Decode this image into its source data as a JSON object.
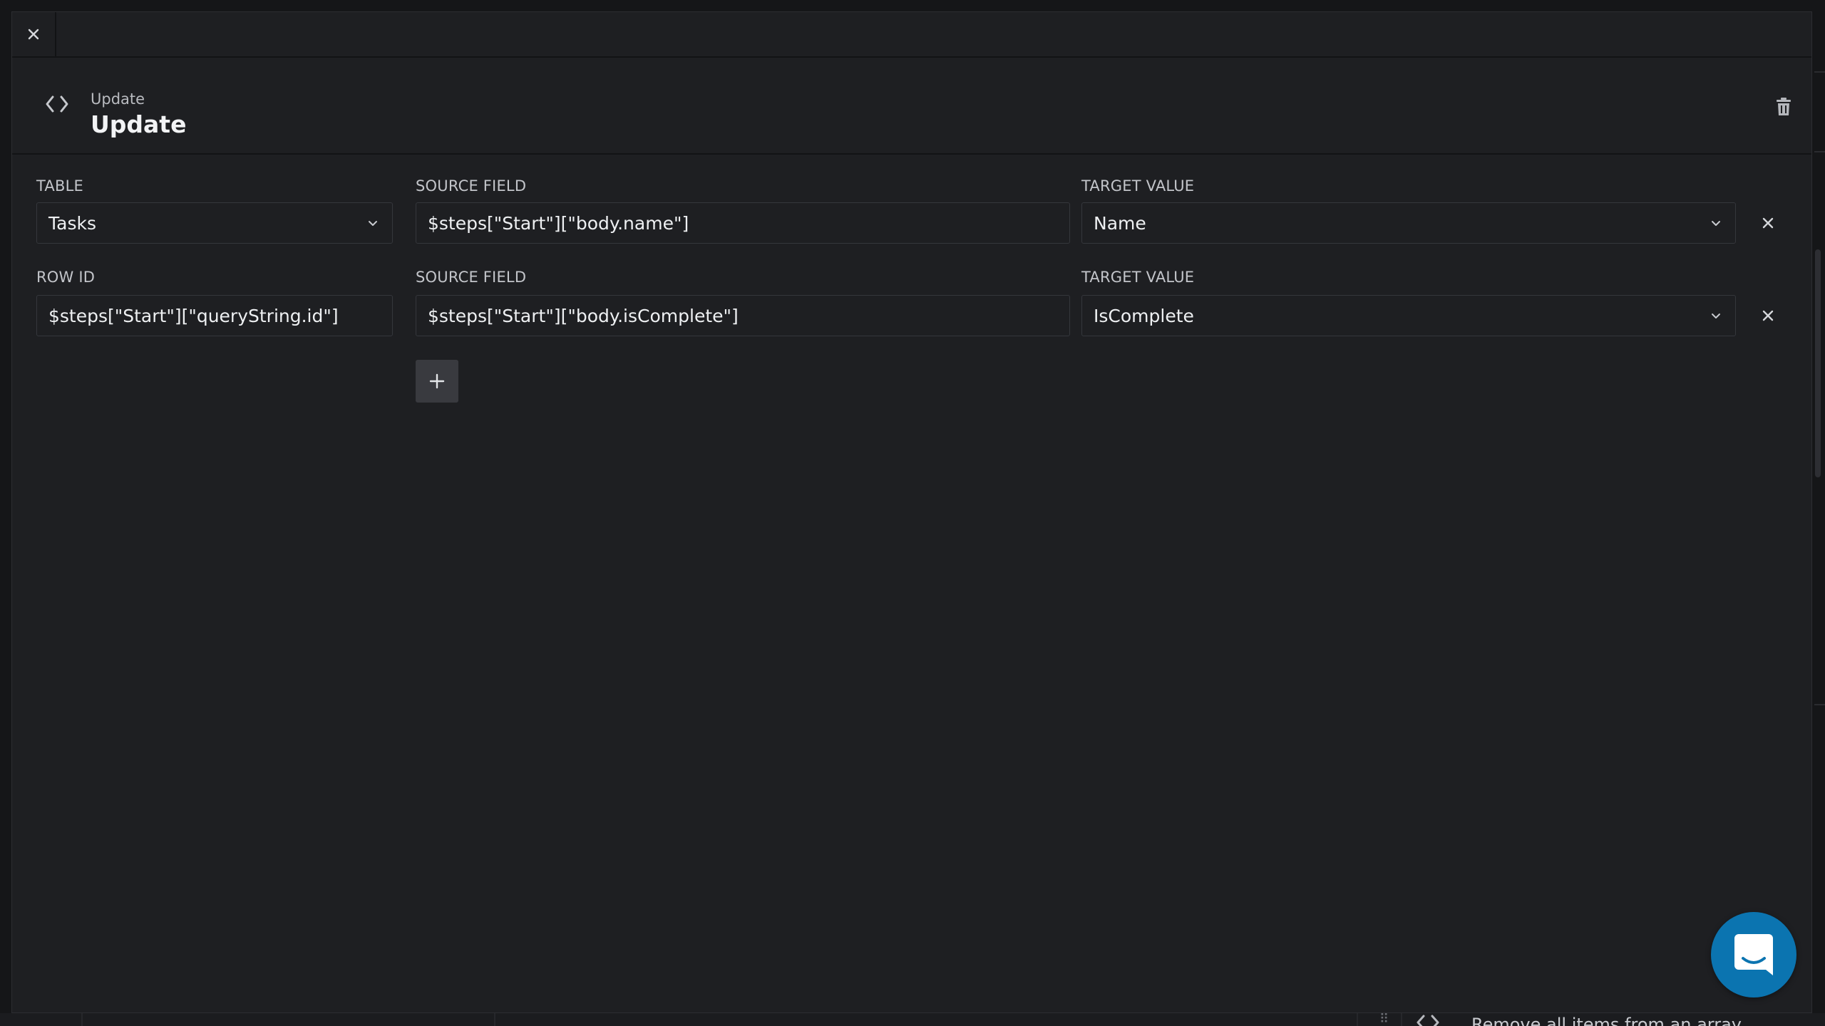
{
  "header": {
    "subtitle": "Update",
    "title": "Update"
  },
  "rows": [
    {
      "left_label": "TABLE",
      "left_value": "Tasks",
      "source_label": "SOURCE FIELD",
      "source_value": "$steps[\"Start\"][\"body.name\"]",
      "target_label": "TARGET VALUE",
      "target_value": "Name"
    },
    {
      "left_label": "ROW ID",
      "left_value": "$steps[\"Start\"][\"queryString.id\"]",
      "source_label": "SOURCE FIELD",
      "source_value": "$steps[\"Start\"][\"body.isComplete\"]",
      "target_label": "TARGET VALUE",
      "target_value": "IsComplete"
    }
  ],
  "background": {
    "partial_text": "Remove all items from an array"
  },
  "icons": {
    "close": "close-icon",
    "code": "code-icon",
    "trash": "trash-icon",
    "chevron": "chevron-down-icon",
    "plus": "plus-icon",
    "chat": "chat-icon"
  },
  "colors": {
    "modal_bg": "#1e1f22",
    "page_bg": "#151618",
    "border": "#35373c",
    "add_button": "#393a3f",
    "chat_button": "#0b74b0"
  }
}
